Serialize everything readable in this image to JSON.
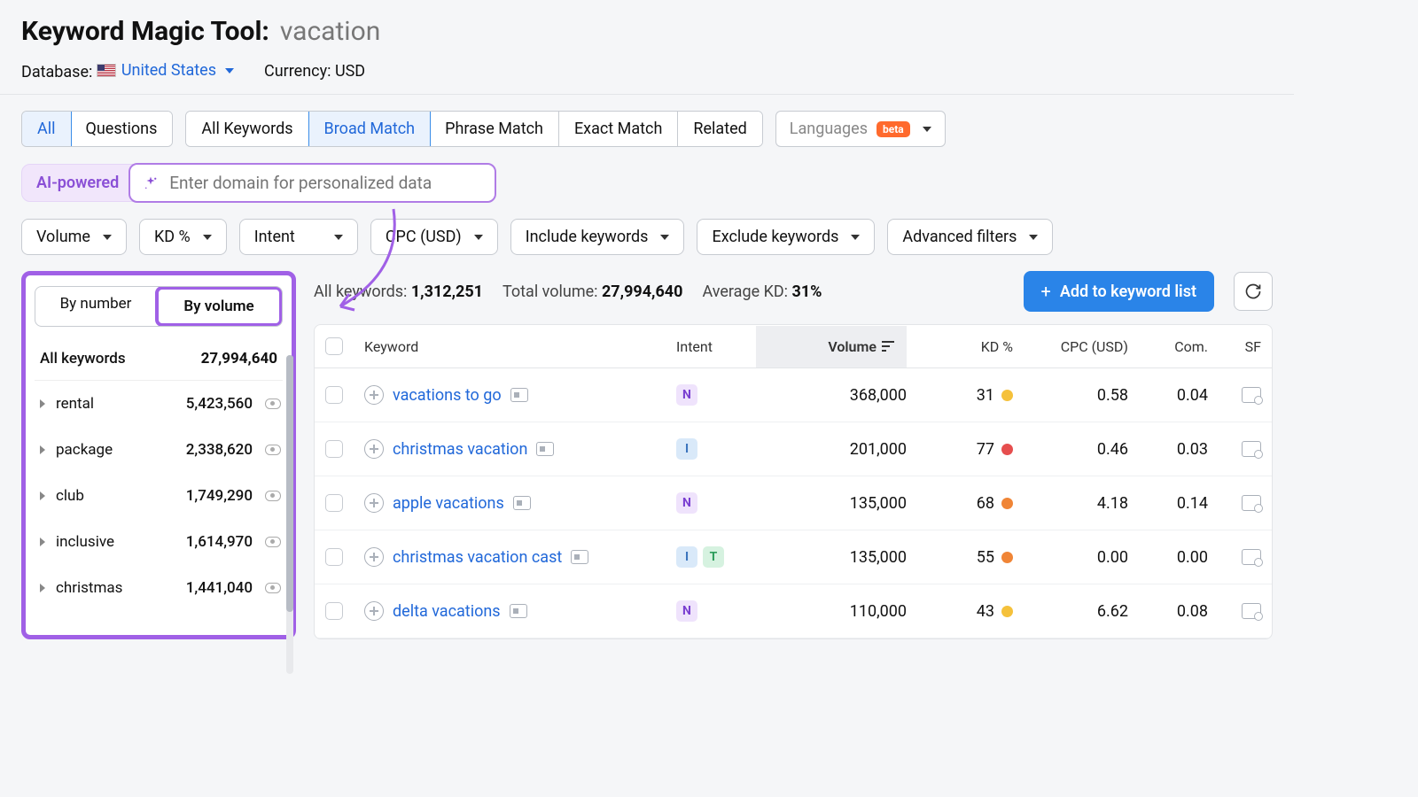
{
  "header": {
    "title": "Keyword Magic Tool:",
    "query": "vacation",
    "database_label": "Database:",
    "country": "United States",
    "currency_label": "Currency:",
    "currency": "USD"
  },
  "modeTabs": {
    "all": "All",
    "questions": "Questions"
  },
  "matchTabs": {
    "all": "All Keywords",
    "broad": "Broad Match",
    "phrase": "Phrase Match",
    "exact": "Exact Match",
    "related": "Related"
  },
  "languages": {
    "label": "Languages",
    "badge": "beta"
  },
  "ai": {
    "label": "AI-powered",
    "placeholder": "Enter domain for personalized data"
  },
  "filters": {
    "volume": "Volume",
    "kd": "KD %",
    "intent": "Intent",
    "cpc": "CPC (USD)",
    "include": "Include keywords",
    "exclude": "Exclude keywords",
    "advanced": "Advanced filters"
  },
  "sidebar": {
    "byNumber": "By number",
    "byVolume": "By volume",
    "allKeywords": "All keywords",
    "allKeywordsCount": "27,994,640",
    "groups": [
      {
        "label": "rental",
        "count": "5,423,560"
      },
      {
        "label": "package",
        "count": "2,338,620"
      },
      {
        "label": "club",
        "count": "1,749,290"
      },
      {
        "label": "inclusive",
        "count": "1,614,970"
      },
      {
        "label": "christmas",
        "count": "1,441,040"
      }
    ]
  },
  "summary": {
    "allKeywordsLabel": "All keywords:",
    "allKeywords": "1,312,251",
    "totalVolumeLabel": "Total volume:",
    "totalVolume": "27,994,640",
    "avgKdLabel": "Average KD:",
    "avgKd": "31%",
    "addBtn": "Add to keyword list"
  },
  "table": {
    "headers": {
      "keyword": "Keyword",
      "intent": "Intent",
      "volume": "Volume",
      "kd": "KD %",
      "cpc": "CPC (USD)",
      "com": "Com.",
      "sf": "SF"
    },
    "rows": [
      {
        "keyword": "vacations to go",
        "intents": [
          "N"
        ],
        "volume": "368,000",
        "kd": "31",
        "kdColor": "y",
        "cpc": "0.58",
        "com": "0.04"
      },
      {
        "keyword": "christmas vacation",
        "intents": [
          "I"
        ],
        "volume": "201,000",
        "kd": "77",
        "kdColor": "r",
        "cpc": "0.46",
        "com": "0.03"
      },
      {
        "keyword": "apple vacations",
        "intents": [
          "N"
        ],
        "volume": "135,000",
        "kd": "68",
        "kdColor": "o",
        "cpc": "4.18",
        "com": "0.14"
      },
      {
        "keyword": "christmas vacation cast",
        "intents": [
          "I",
          "T"
        ],
        "volume": "135,000",
        "kd": "55",
        "kdColor": "o",
        "cpc": "0.00",
        "com": "0.00"
      },
      {
        "keyword": "delta vacations",
        "intents": [
          "N"
        ],
        "volume": "110,000",
        "kd": "43",
        "kdColor": "y",
        "cpc": "6.62",
        "com": "0.08"
      }
    ]
  }
}
